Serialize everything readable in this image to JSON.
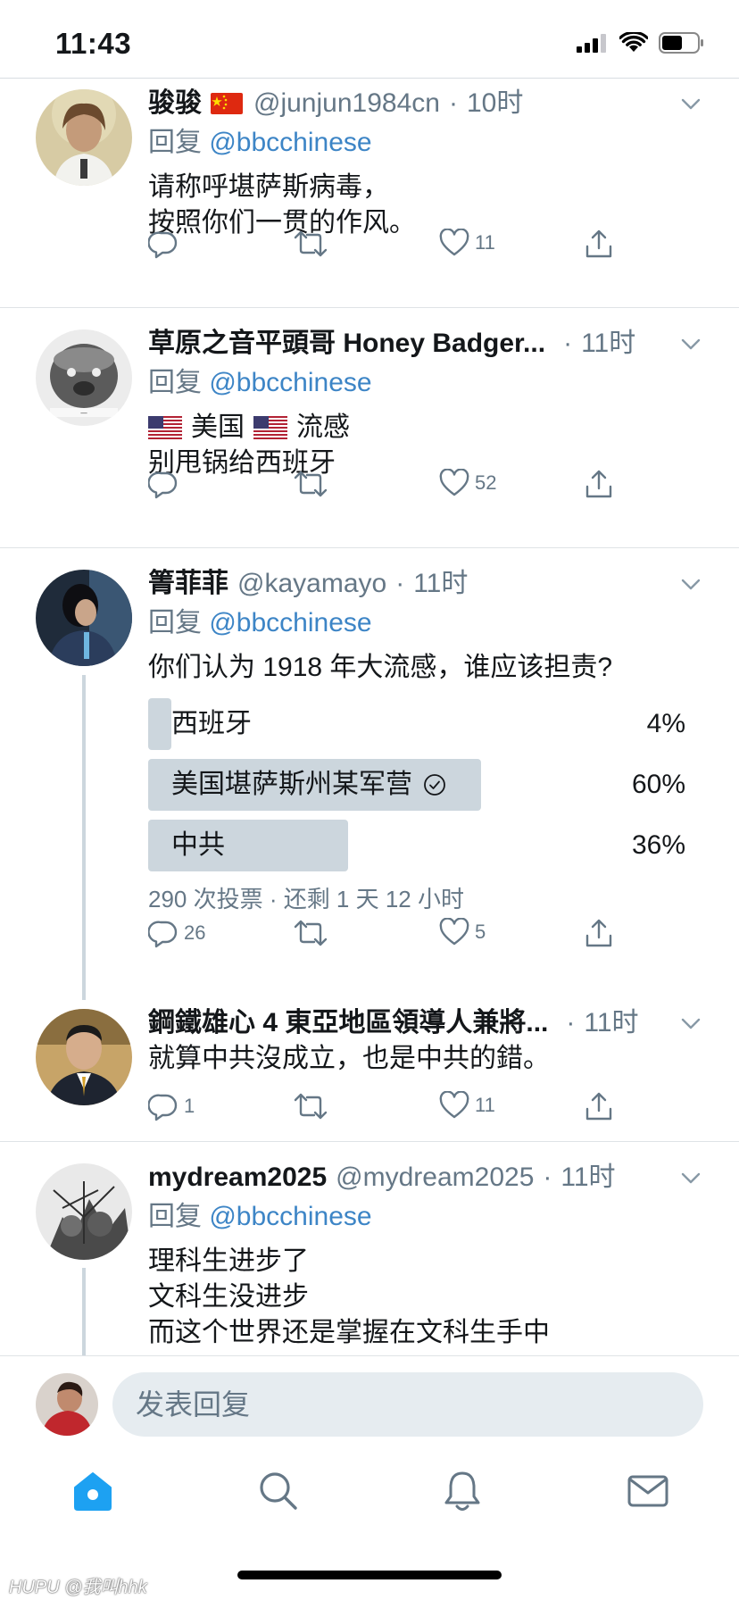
{
  "status_bar": {
    "time": "11:43"
  },
  "tweets": [
    {
      "name": "骏骏",
      "handle": "@junjun1984cn",
      "dot": "·",
      "time": "10时",
      "reply_prefix": "回复",
      "reply_to": "@bbcchinese",
      "lines": [
        "请称呼堪萨斯病毒，",
        "按照你们一贯的作风。"
      ],
      "likes": "11"
    },
    {
      "name": "草原之音平頭哥 Honey Badger...",
      "dot": "·",
      "time": "11时",
      "reply_prefix": "回复",
      "reply_to": "@bbcchinese",
      "line1_a": "美国",
      "line1_b": "流感",
      "line2": "别甩锅给西班牙",
      "likes": "52"
    },
    {
      "name": "箐菲菲",
      "handle": "@kayamayo",
      "dot": "·",
      "time": "11时",
      "reply_prefix": "回复",
      "reply_to": "@bbcchinese",
      "question": "你们认为 1918 年大流感，谁应该担责?",
      "poll": [
        {
          "label": "西班牙",
          "percent": "4%",
          "fraction": 0.04
        },
        {
          "label": "美国堪萨斯州某军营",
          "percent": "60%",
          "fraction": 0.6
        },
        {
          "label": "中共",
          "percent": "36%",
          "fraction": 0.36
        }
      ],
      "poll_meta": "290 次投票 · 还剩 1 天 12 小时",
      "replies": "26",
      "likes": "5"
    },
    {
      "name": "鋼鐵雄心 4 東亞地區領導人兼將...",
      "dot": "·",
      "time": "11时",
      "text": "就算中共沒成立，也是中共的錯。",
      "replies": "1",
      "likes": "11"
    },
    {
      "name": "mydream2025",
      "handle": "@mydream2025",
      "dot": "·",
      "time": "11时",
      "reply_prefix": "回复",
      "reply_to": "@bbcchinese",
      "lines": [
        "理科生进步了",
        "文科生没进步",
        "而这个世界还是掌握在文科生手中"
      ]
    }
  ],
  "composer": {
    "placeholder": "发表回复"
  },
  "tabs": [
    "home-icon",
    "search-icon",
    "notifications-icon",
    "messages-icon"
  ],
  "colors": {
    "accent": "#1da1f2",
    "link": "#3d85c6",
    "muted": "#657786",
    "poll_fill": "#ccd6dd"
  },
  "watermark": {
    "brand": "HUPU",
    "user": "@我叫hhk"
  }
}
